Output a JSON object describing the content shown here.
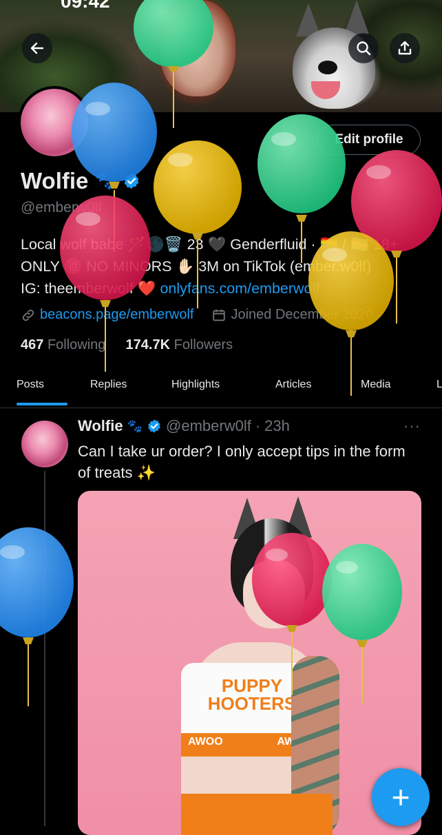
{
  "statusbar": {
    "time": "09:42"
  },
  "header": {
    "back_icon": "arrow-left-icon",
    "search_icon": "search-icon",
    "share_icon": "share-icon"
  },
  "profile": {
    "edit_label": "Edit profile",
    "name": "Wolfie",
    "name_emoji": "🐾",
    "handle": "@emberw0lf",
    "bio_line1": "Local wolf babe 🪄🌑🗑️ 23 🖤 Genderfluid · 🏳️‍🌈 / 🏳️‍⚧️ 18+",
    "bio_line2": "ONLY 🔞 NO MINORS ✋🏻 3M on TikTok (ember.w0lf)",
    "bio_line3_prefix": "IG: theemberwolf ❤️ ",
    "bio_link": "onlyfans.com/emberwolf",
    "website": "beacons.page/emberwolf",
    "joined": "Joined December 2020",
    "following_count": "467",
    "following_label": "Following",
    "followers_count": "174.7K",
    "followers_label": "Followers"
  },
  "tabs": [
    "Posts",
    "Replies",
    "Highlights",
    "Articles",
    "Media",
    "L"
  ],
  "tweet": {
    "name": "Wolfie",
    "name_emoji": "🐾",
    "handle": "@emberw0lf",
    "time": "23h",
    "text": "Can I take ur order? I only accept tips in the form of treats ✨",
    "more": "···",
    "media_logo": "PUPPY HOOTERS",
    "media_band_left": "AWOO",
    "media_band_right": "AWOO"
  },
  "fab": {
    "label": "+"
  },
  "colors": {
    "accent": "#1d9bf0",
    "muted": "#71767b",
    "text": "#e7e9ea",
    "background": "#000000"
  }
}
